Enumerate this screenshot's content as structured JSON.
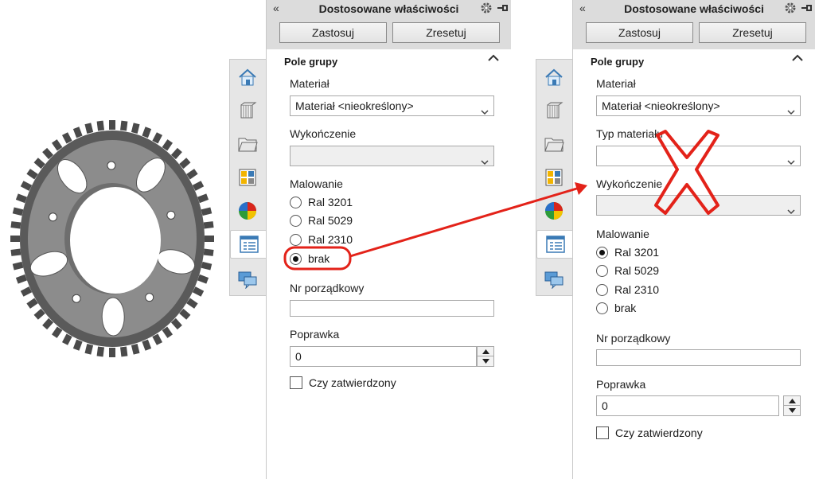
{
  "colors": {
    "highlight": "#e32219",
    "panel_bg": "#ffffff",
    "titlebar_bg": "#dcdcdc"
  },
  "sidebar_icons": [
    "home-icon",
    "books-icon",
    "folder-icon",
    "design-library-icon",
    "appearance-icon",
    "custom-properties-icon",
    "comments-icon"
  ],
  "left_panel": {
    "title": "Dostosowane właściwości",
    "apply_label": "Zastosuj",
    "reset_label": "Zresetuj",
    "group_label": "Pole grupy",
    "material_label": "Materiał",
    "material_value": "Materiał <nieokreślony>",
    "finish_label": "Wykończenie",
    "finish_value": "",
    "painting_label": "Malowanie",
    "painting_options": [
      "Ral 3201",
      "Ral 5029",
      "Ral 2310",
      "brak"
    ],
    "painting_selected": "brak",
    "order_label": "Nr porządkowy",
    "order_value": "",
    "revision_label": "Poprawka",
    "revision_value": "0",
    "approved_label": "Czy zatwierdzony",
    "approved_checked": false
  },
  "right_panel": {
    "title": "Dostosowane właściwości",
    "apply_label": "Zastosuj",
    "reset_label": "Zresetuj",
    "group_label": "Pole grupy",
    "material_label": "Materiał",
    "material_value": "Materiał <nieokreślony>",
    "material_type_label": "Typ materiału",
    "material_type_value": "",
    "finish_label": "Wykończenie",
    "finish_value": "",
    "painting_label": "Malowanie",
    "painting_options": [
      "Ral 3201",
      "Ral 5029",
      "Ral 2310",
      "brak"
    ],
    "painting_selected": "Ral 3201",
    "order_label": "Nr porządkowy",
    "order_value": "",
    "revision_label": "Poprawka",
    "revision_value": "0",
    "approved_label": "Czy zatwierdzony",
    "approved_checked": false
  }
}
